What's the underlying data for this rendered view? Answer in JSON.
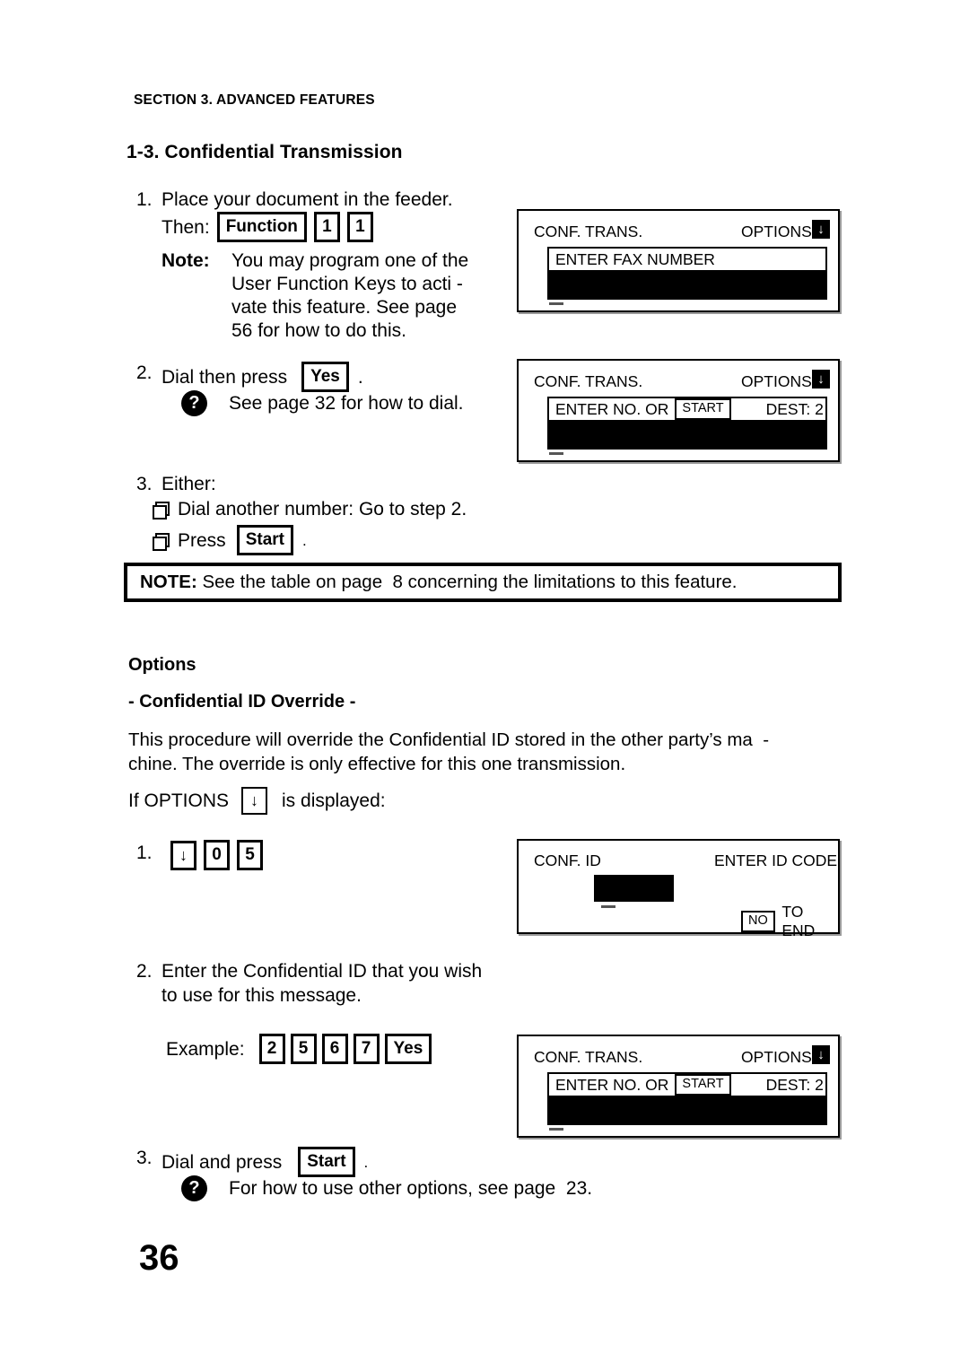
{
  "page": {
    "running_header": "SECTION 3. ADVANCED FEATURES",
    "chapter_title": "1-3. Confidential Transmission",
    "page_number": "36"
  },
  "procedure_main": {
    "step1": {
      "number": "1.",
      "text": "Place your document in the feeder.",
      "then_label": "Then:",
      "keys": [
        {
          "label": "Function",
          "type": "wide"
        },
        {
          "label": "1",
          "type": "num"
        },
        {
          "label": "1",
          "type": "num"
        }
      ],
      "note": {
        "label": "Note:",
        "lines": [
          "You may program one of the",
          "User Function Keys to acti -",
          "vate this feature. See page",
          "56 for how to do this."
        ]
      }
    },
    "step2": {
      "number": "2.",
      "text_before": "Dial then press",
      "key": "Yes",
      "text_after": ".",
      "hint_icon": "?",
      "hint": "See page 32 for how to dial."
    },
    "step3": {
      "number": "3.",
      "text": "Either:",
      "bullets": [
        {
          "text": "Dial another number: Go to step 2.",
          "key": ""
        },
        {
          "text_before": "Press",
          "key": "Start",
          "text_after": "."
        }
      ]
    }
  },
  "note_callout": {
    "label": "NOTE:",
    "text": " See the table on page  8 concerning the limitations to this feature."
  },
  "options_section": {
    "heading": "Options",
    "subheading": "- Confidential ID Override -",
    "paragraph_lines": [
      "This procedure will override the Confidential ID stored in the other party’s ma  -",
      "chine. The override is only effective for this one transmission."
    ],
    "condition": {
      "text_before": "If OPTIONS",
      "key": "↓",
      "text_after": "is displayed:"
    },
    "step1": {
      "number": "1.",
      "keys": [
        {
          "label": "↓",
          "type": "arrow"
        },
        {
          "label": "0",
          "type": "num"
        },
        {
          "label": "5",
          "type": "num"
        }
      ]
    },
    "step2": {
      "number": "2.",
      "lines": [
        "Enter the Confidential ID that you wish",
        "to use for this message."
      ],
      "example_label": "Example:",
      "example_keys": [
        {
          "label": "2",
          "type": "num"
        },
        {
          "label": "5",
          "type": "num"
        },
        {
          "label": "6",
          "type": "num"
        },
        {
          "label": "7",
          "type": "num"
        },
        {
          "label": "Yes",
          "type": "wide"
        }
      ]
    },
    "step3": {
      "number": "3.",
      "text_before": "Dial and press",
      "key": "Start",
      "text_after": ".",
      "hint_icon": "?",
      "hint": "For how to use other options, see page  23."
    }
  },
  "displays": [
    {
      "id": "display-1",
      "title": "CONF. TRANS.",
      "options_label": "OPTIONS",
      "options_arrow": "↓",
      "field_text": "ENTER FAX NUMBER",
      "field_key": "",
      "field_right": "",
      "has_black_bar": true,
      "cursor": true
    },
    {
      "id": "display-2",
      "title": "CONF. TRANS.",
      "options_label": "OPTIONS",
      "options_arrow": "↓",
      "field_text": "ENTER NO. OR",
      "field_key": "START",
      "field_right": "DEST: 2",
      "has_black_bar": true,
      "cursor": true
    },
    {
      "id": "display-3",
      "title": "CONF. ID",
      "options_label": "ENTER ID CODE",
      "options_arrow": "",
      "field_text": "",
      "field_key": "NO",
      "field_right": "TO END",
      "has_black_bar": true,
      "cursor": true
    },
    {
      "id": "display-4",
      "title": "CONF. TRANS.",
      "options_label": "OPTIONS",
      "options_arrow": "↓",
      "field_text": "ENTER NO. OR",
      "field_key": "START",
      "field_right": "DEST: 2",
      "has_black_bar": true,
      "cursor": true
    }
  ]
}
